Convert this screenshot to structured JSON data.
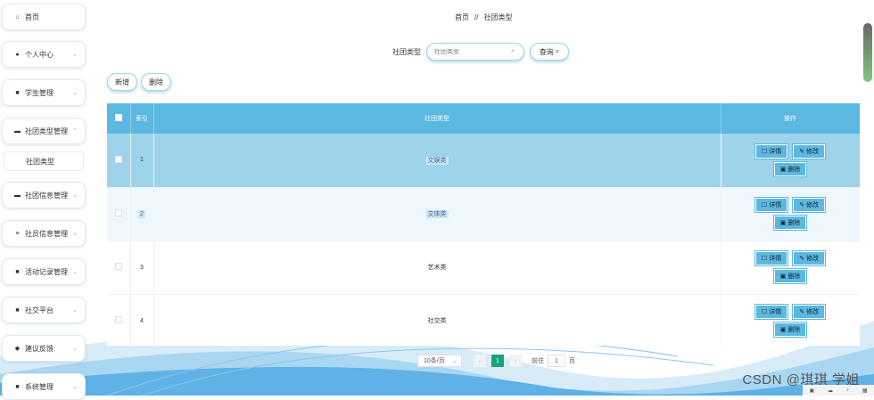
{
  "sidebar": {
    "items": [
      {
        "label": "首页",
        "icon": "home-icon",
        "glyph": "⌂",
        "chevron": false
      },
      {
        "label": "个人中心",
        "icon": "user-icon",
        "glyph": "●",
        "chevron": true
      },
      {
        "label": "学生管理",
        "icon": "grid-icon",
        "glyph": "■",
        "chevron": true
      },
      {
        "label": "社团类型管理",
        "icon": "card-icon",
        "glyph": "▬",
        "chevron": true
      },
      {
        "label": "社团信息管理",
        "icon": "monitor-icon",
        "glyph": "▬",
        "chevron": true
      },
      {
        "label": "社员信息管理",
        "icon": "list-icon",
        "glyph": "≡",
        "chevron": true
      },
      {
        "label": "活动记录管理",
        "icon": "grid-icon",
        "glyph": "■",
        "chevron": true
      },
      {
        "label": "社交平台",
        "icon": "grid-icon",
        "glyph": "■",
        "chevron": true
      },
      {
        "label": "建议反馈",
        "icon": "chat-icon",
        "glyph": "◆",
        "chevron": true
      },
      {
        "label": "系统管理",
        "icon": "grid-icon",
        "glyph": "■",
        "chevron": true
      }
    ],
    "sub_item": "社团类型"
  },
  "breadcrumb": {
    "home": "首页",
    "sep": "//",
    "current": "社团类型"
  },
  "search": {
    "label": "社团类型",
    "placeholder": "社团类型",
    "button": "查询"
  },
  "actions": {
    "add": "新增",
    "delete": "删除"
  },
  "table": {
    "headers": {
      "index": "索引",
      "type": "社团类型",
      "ops": "操作"
    },
    "rows": [
      {
        "index": "1",
        "type": "文娱类"
      },
      {
        "index": "2",
        "type": "文体类"
      },
      {
        "index": "3",
        "type": "艺术类"
      },
      {
        "index": "4",
        "type": "社交类"
      }
    ],
    "op_labels": {
      "detail": "详情",
      "edit": "修改",
      "delete": "删除"
    }
  },
  "pagination": {
    "page_size": "10条/页",
    "current_page": "1",
    "goto_label": "前往",
    "goto_value": "1",
    "page_suffix": "页"
  },
  "watermark": "CSDN @琪琪 学姐",
  "colors": {
    "accent": "#5bb8e0",
    "selected_row": "#9fd3ea",
    "page_active": "#1aa37a"
  }
}
